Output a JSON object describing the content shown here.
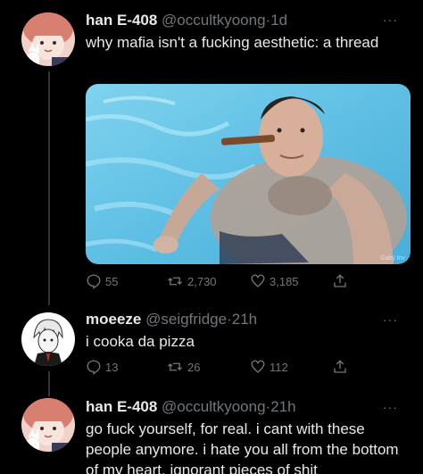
{
  "tweets": [
    {
      "name": "han E-408",
      "handle": "@occultkyoong",
      "separator": "·",
      "time": "1d",
      "text": "why mafia isn't a fucking aesthetic: a thread",
      "replies": "55",
      "retweets": "2,730",
      "likes": "3,185",
      "media_watermark": "Gaby Inv"
    },
    {
      "name": "moeeze",
      "handle": "@seigfridge",
      "separator": "·",
      "time": "21h",
      "text": "i cooka da pizza",
      "replies": "13",
      "retweets": "26",
      "likes": "112"
    },
    {
      "name": "han E-408",
      "handle": "@occultkyoong",
      "separator": "·",
      "time": "21h",
      "text": "go fuck yourself, for real. i cant with these people anymore. i hate you all from the bottom of my heart. ignorant pieces of shit"
    }
  ],
  "more_label": "···",
  "icons": {
    "reply": "reply-icon",
    "retweet": "retweet-icon",
    "like": "heart-icon",
    "share": "share-icon",
    "more": "more-icon"
  },
  "colors": {
    "background": "#000000",
    "text": "#e7e9ea",
    "secondary": "#71767b",
    "thread_line": "#333639"
  }
}
